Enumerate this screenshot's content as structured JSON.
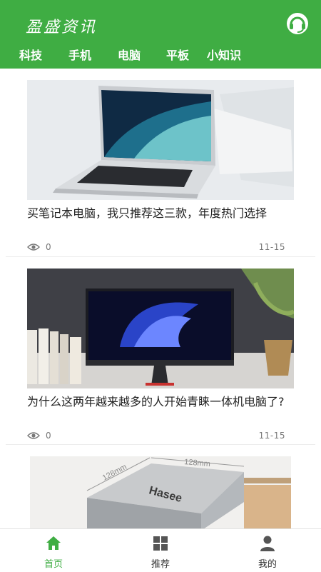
{
  "header": {
    "app_title": "盈盛资讯",
    "support_icon": "headset-icon",
    "background_color": "#3fad43"
  },
  "tabs": [
    {
      "label": "科技"
    },
    {
      "label": "手机"
    },
    {
      "label": "电脑"
    },
    {
      "label": "平板"
    },
    {
      "label": "小知识"
    }
  ],
  "articles": [
    {
      "title": "买笔记本电脑，我只推荐这三款，年度热门选择",
      "views": "0",
      "date": "11-15",
      "image": "laptop-photo"
    },
    {
      "title": "为什么这两年越来越多的人开始青睐一体机电脑了?",
      "views": "0",
      "date": "11-15",
      "image": "all-in-one-pc-photo"
    },
    {
      "title": "",
      "image": "mini-pc-photo",
      "box_labels": [
        "128mm",
        "128mm",
        "Hasee"
      ]
    }
  ],
  "bottom_nav": [
    {
      "label": "首页",
      "icon": "home-icon",
      "active": true
    },
    {
      "label": "推荐",
      "icon": "grid-icon",
      "active": false
    },
    {
      "label": "我的",
      "icon": "user-icon",
      "active": false
    }
  ],
  "colors": {
    "accent": "#3fad43",
    "inactive_icon": "#555555"
  }
}
